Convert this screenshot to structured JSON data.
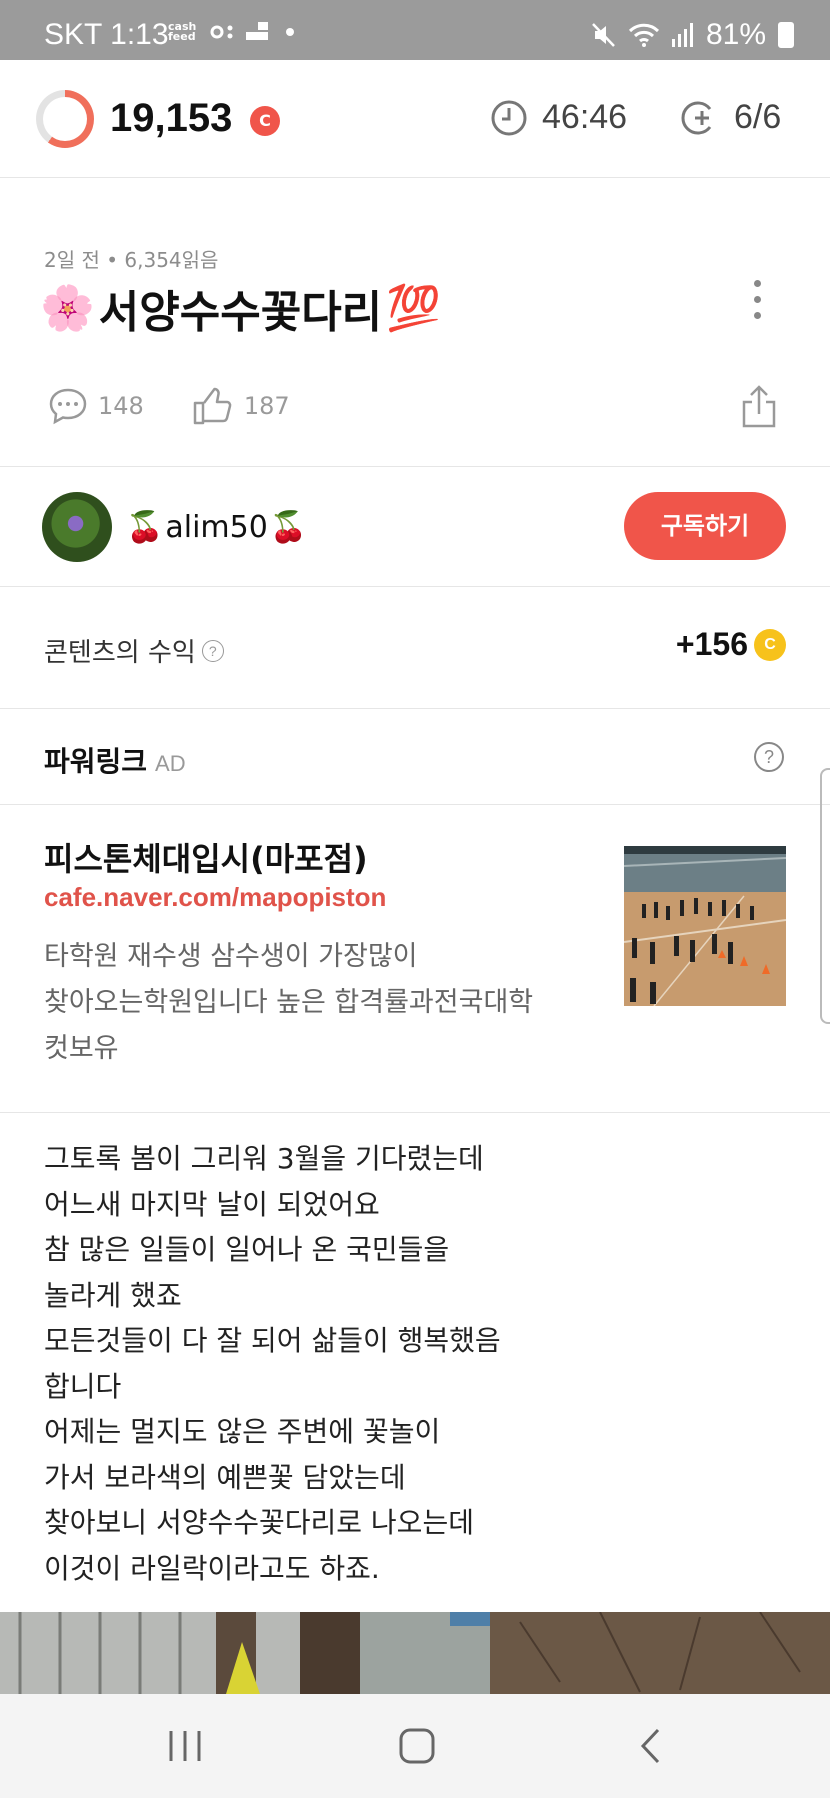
{
  "status_bar": {
    "carrier_time": "SKT 1:13",
    "cashfeed_text": "cash feed",
    "battery": "81%"
  },
  "top_bar": {
    "points": "19,153",
    "points_badge": "C",
    "timer": "46:46",
    "count": "6/6",
    "progress_fraction": 0.6
  },
  "post": {
    "meta": "2일 전 • 6,354읽음",
    "title_emoji_left": "🌸",
    "title": "서양수수꽃다리",
    "title_emoji_right": "💯",
    "comments": "148",
    "likes": "187"
  },
  "author": {
    "emoji_left": "🍒",
    "name": "alim50",
    "emoji_right": "🍒",
    "subscribe_label": "구독하기"
  },
  "revenue": {
    "label": "콘텐츠의 수익",
    "help": "?",
    "value": "+156",
    "coin": "C"
  },
  "powerlink": {
    "title": "파워링크",
    "ad_tag": "AD",
    "help": "?",
    "ad": {
      "title": "피스톤체대입시(마포점)",
      "url": "cafe.naver.com/mapopiston",
      "desc": [
        "타학원 재수생 삼수생이 가장많이",
        "찾아오는학원입니다 높은 합격률과전국대학",
        "컷보유"
      ]
    }
  },
  "body_lines": [
    "그토록 봄이 그리워 3월을 기다렸는데",
    "어느새 마지막 날이 되었어요",
    "참 많은 일들이 일어나 온 국민들을",
    "놀라게 했죠",
    "모든것들이 다 잘 되어 삶들이 행복했음",
    "합니다",
    "어제는 멀지도 않은 주변에 꽃놀이",
    "가서 보라색의 예쁜꽃 담았는데",
    "찾아보니 서양수수꽃다리로 나오는데",
    "이것이 라일락이라고도 하죠."
  ],
  "icons": [
    "mute-icon",
    "wifi-icon",
    "signal-icon",
    "battery-icon",
    "clock-icon",
    "coin-plus-icon",
    "comment-icon",
    "thumbs-up-icon",
    "share-icon",
    "more-vert-icon",
    "recents-icon",
    "home-icon",
    "back-icon"
  ],
  "colors": {
    "accent": "#f0554a",
    "coin": "#f7c21b",
    "url": "#e0534a"
  }
}
